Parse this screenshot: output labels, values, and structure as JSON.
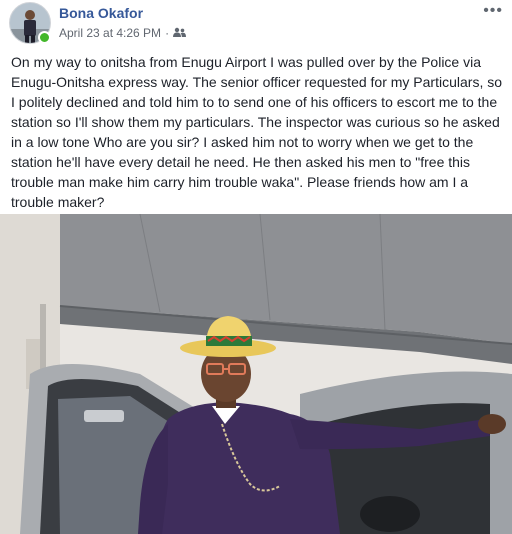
{
  "post": {
    "author": "Bona Okafor",
    "timestamp": "April 23 at 4:26 PM",
    "separator": "·",
    "audience_icon": "friends-icon",
    "more_label": "•••",
    "text": "On my way to onitsha from Enugu Airport I was pulled over by the Police via Enugu-Onitsha express way. The senior officer requested for my Particulars, so I politely declined and told him to to send one of his officers to escort me to the station so I'll show them my particulars. The inspector was curious so he asked in a low tone Who are you sir? I asked him not to worry when we get to the station he'll have every detail he need. He then asked his men to \"free this trouble man make him carry him trouble waka\". Please friends how am I a trouble maker?"
  },
  "colors": {
    "author_link": "#365899",
    "meta_gray": "#616770",
    "online": "#42b72a",
    "suit_purple": "#3f2d5c",
    "hat_yellow": "#e8c75a"
  }
}
